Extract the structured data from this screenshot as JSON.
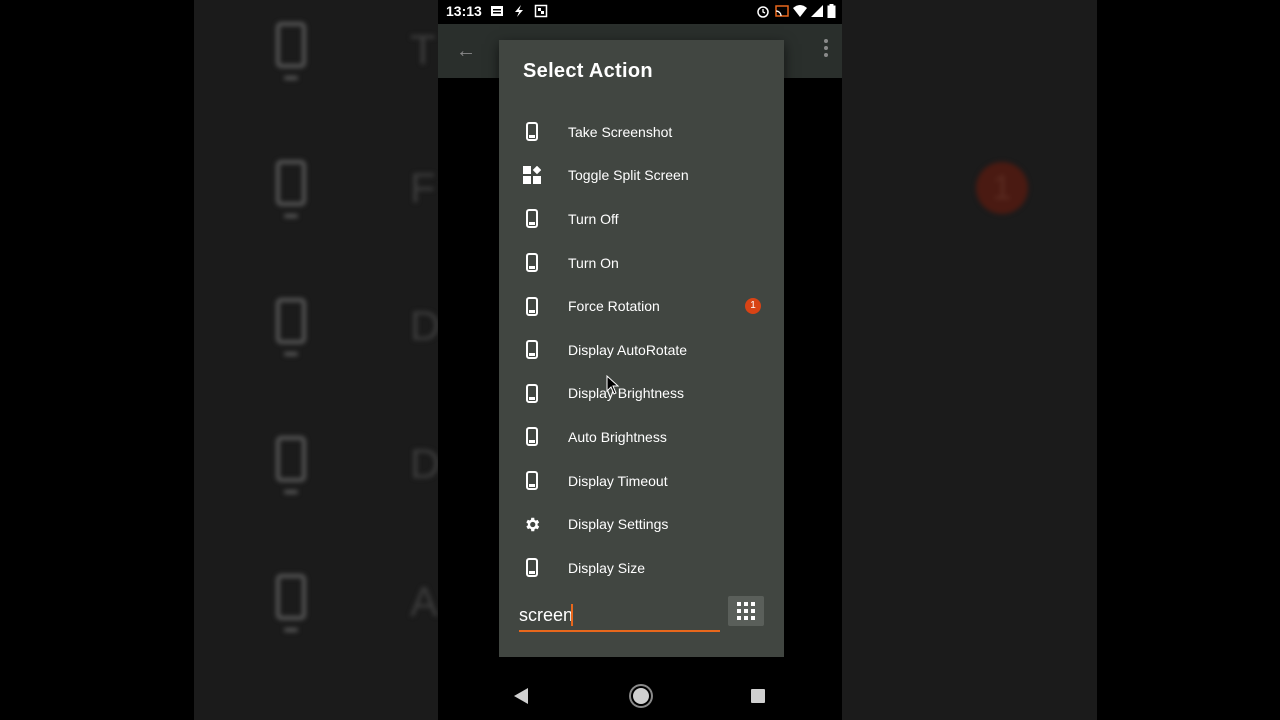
{
  "status_bar": {
    "time": "13:13",
    "icons_left": [
      "sim-card-icon",
      "flash-icon",
      "screenshot-icon"
    ],
    "icons_right": [
      "alarm-icon",
      "cast-icon",
      "wifi-icon",
      "signal-icon",
      "battery-icon"
    ]
  },
  "background": {
    "letters": [
      "T",
      "F",
      "D",
      "D",
      "A"
    ],
    "right_badge": "1"
  },
  "dialog": {
    "title": "Select  Action",
    "items": [
      {
        "label": "Take Screenshot",
        "icon": "phone-icon"
      },
      {
        "label": "Toggle Split Screen",
        "icon": "widgets-icon"
      },
      {
        "label": "Turn Off",
        "icon": "phone-icon"
      },
      {
        "label": "Turn On",
        "icon": "phone-icon"
      },
      {
        "label": "Force Rotation",
        "icon": "phone-icon",
        "badge": "1"
      },
      {
        "label": "Display AutoRotate",
        "icon": "phone-icon"
      },
      {
        "label": "Display Brightness",
        "icon": "phone-icon"
      },
      {
        "label": "Auto Brightness",
        "icon": "phone-icon"
      },
      {
        "label": "Display Timeout",
        "icon": "phone-icon"
      },
      {
        "label": "Display Settings",
        "icon": "gear-icon"
      },
      {
        "label": "Display Size",
        "icon": "phone-icon"
      }
    ],
    "search_value": "screen",
    "grid_button_icon": "grid-icon"
  },
  "colors": {
    "dialog_bg": "#414641",
    "accent": "#e8671c",
    "badge": "#d84315"
  }
}
